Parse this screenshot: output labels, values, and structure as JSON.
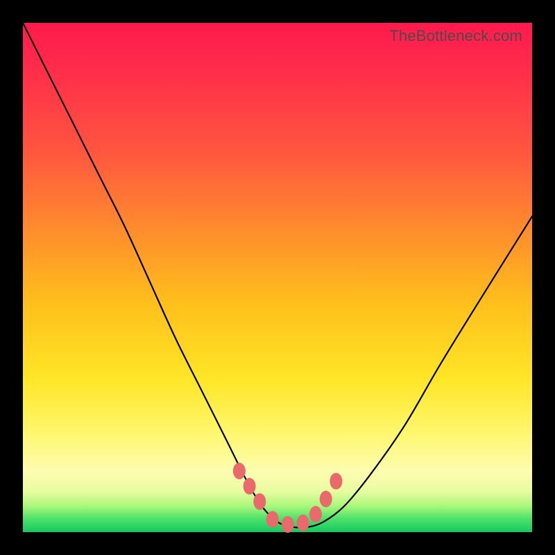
{
  "attribution": "TheBottleneck.com",
  "colors": {
    "background": "#000000",
    "gradient_top": "#ff1a4d",
    "gradient_mid": "#ffe627",
    "gradient_bottom": "#13c95e",
    "curve": "#000000",
    "marker": "#e86a6a"
  },
  "chart_data": {
    "type": "line",
    "title": "",
    "xlabel": "",
    "ylabel": "",
    "xlim": [
      0,
      100
    ],
    "ylim": [
      0,
      100
    ],
    "series": [
      {
        "name": "bottleneck-curve",
        "x": [
          0,
          5,
          10,
          15,
          20,
          25,
          30,
          35,
          40,
          44,
          47,
          50,
          53,
          56,
          59,
          63,
          68,
          75,
          82,
          90,
          100
        ],
        "y": [
          100,
          90,
          80,
          70,
          60,
          49,
          38,
          28,
          18,
          10,
          5,
          2,
          1,
          1,
          2,
          5,
          11,
          21,
          33,
          46,
          62
        ]
      }
    ],
    "markers": {
      "name": "highlight-points",
      "x": [
        42.5,
        44.5,
        46.5,
        49,
        52,
        55,
        57.5,
        59.5,
        61.5
      ],
      "y": [
        12,
        9,
        6,
        2.5,
        1.5,
        1.8,
        3.5,
        6.5,
        10
      ]
    }
  }
}
